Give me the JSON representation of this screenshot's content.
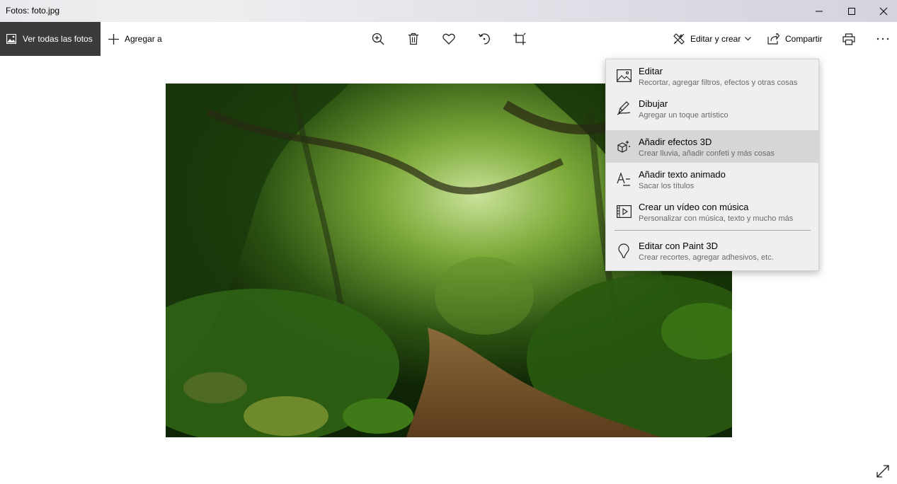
{
  "window": {
    "title": "Fotos: foto.jpg",
    "controls": [
      "minimize-icon",
      "maximize-icon",
      "close-icon"
    ]
  },
  "toolbar": {
    "view_all_label": "Ver todas las fotos",
    "add_to_label": "Agregar a",
    "center_icons": [
      "zoom-in-icon",
      "delete-icon",
      "favorite-icon",
      "rotate-icon",
      "crop-icon"
    ],
    "edit_create_label": "Editar y crear",
    "share_label": "Compartir",
    "right_icons": [
      "print-icon",
      "more-icon"
    ]
  },
  "menu": {
    "items": [
      {
        "title": "Editar",
        "subtitle": "Recortar, agregar filtros, efectos y otras cosas",
        "icon": "edit-image-icon"
      },
      {
        "title": "Dibujar",
        "subtitle": "Agregar un toque artístico",
        "icon": "draw-pen-icon"
      },
      {
        "title": "Añadir efectos 3D",
        "subtitle": "Crear lluvia, añadir confeti y más cosas",
        "icon": "effects-3d-icon",
        "highlighted": true
      },
      {
        "title": "Añadir texto animado",
        "subtitle": "Sacar los títulos",
        "icon": "animated-text-icon"
      },
      {
        "title": "Crear un vídeo con música",
        "subtitle": "Personalizar con música, texto y mucho más",
        "icon": "video-music-icon"
      },
      {
        "title": "Editar con Paint 3D",
        "subtitle": "Crear recortes, agregar adhesivos, etc.",
        "icon": "paint-3d-icon"
      }
    ]
  },
  "photo": {
    "subject": "forest-path-photo"
  },
  "colors": {
    "view_all_bg": "#3b3b3b",
    "menu_bg": "#efefef",
    "menu_highlight": "#d6d6d6"
  }
}
